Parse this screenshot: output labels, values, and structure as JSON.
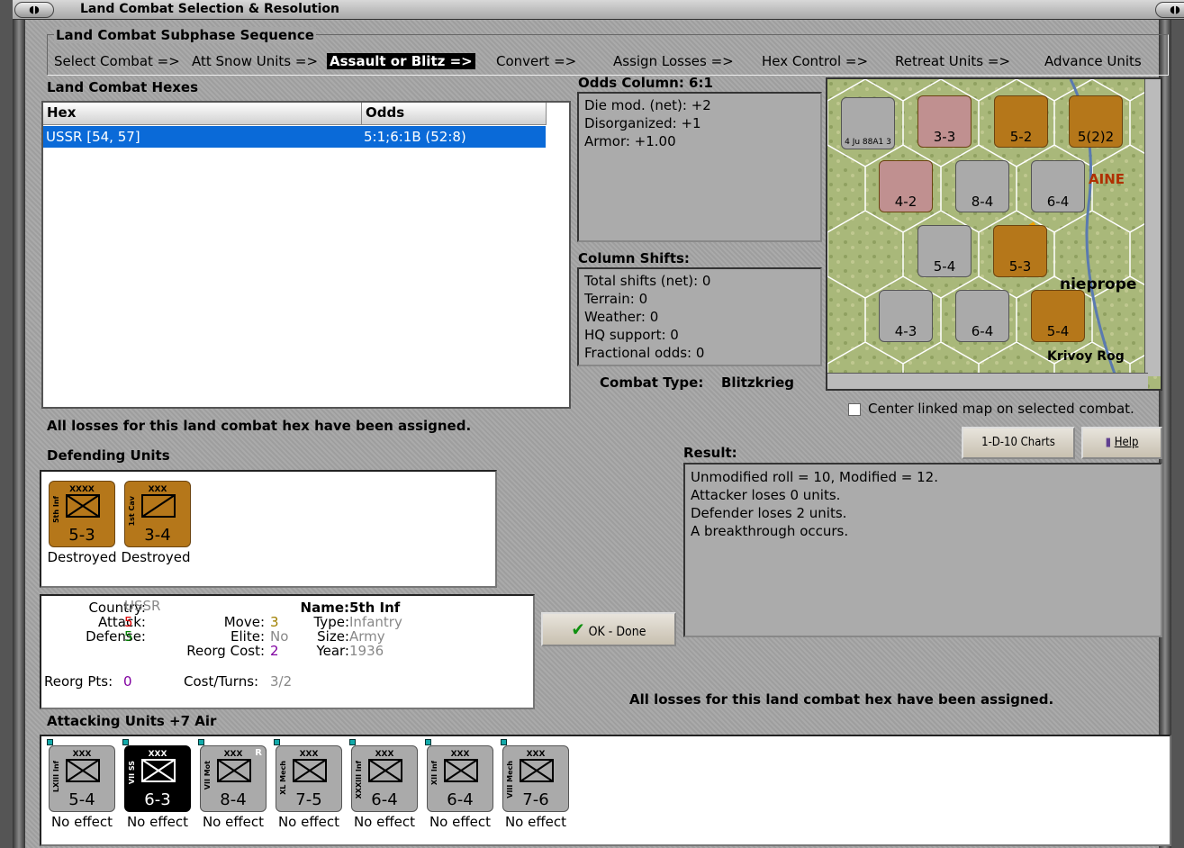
{
  "window": {
    "title": "Land Combat Selection & Resolution"
  },
  "sequence": {
    "title": "Land Combat Subphase Sequence",
    "steps": [
      "Select Combat =>",
      "Att Snow Units =>",
      "Assault or Blitz =>",
      "Convert =>",
      "Assign Losses =>",
      "Hex Control =>",
      "Retreat Units =>",
      "Advance Units"
    ],
    "active_step": "Assault or Blitz =>"
  },
  "combat_hexes": {
    "title": "Land Combat Hexes",
    "columns": [
      "Hex",
      "Odds"
    ],
    "rows": [
      {
        "hex": "USSR [54, 57]",
        "odds": "5:1;6:1B (52:8)"
      }
    ]
  },
  "odds": {
    "title": "Odds Column: 6:1",
    "lines": [
      "Die mod. (net): +2",
      "Disorganized: +1",
      "Armor: +1.00"
    ]
  },
  "shifts": {
    "title": "Column Shifts:",
    "lines": [
      "Total shifts (net): 0",
      "Terrain: 0",
      "Weather: 0",
      "HQ support: 0",
      "Fractional odds: 0"
    ]
  },
  "combat_type": {
    "label": "Combat Type:",
    "value": "Blitzkrieg"
  },
  "map": {
    "center_checkbox_label": "Center linked map on selected combat.",
    "place_labels": [
      "AINE",
      "nieprope",
      "Krivoy Rog"
    ]
  },
  "buttons": {
    "charts": "1-D-10 Charts",
    "help": "Help",
    "ok": "OK - Done"
  },
  "losses_message": "All losses for this land combat hex have been assigned.",
  "result": {
    "title": "Result:",
    "lines": [
      "Unmodified roll = 10, Modified = 12.",
      "Attacker loses 0 units.",
      "Defender loses 2 units.",
      "A breakthrough occurs."
    ]
  },
  "defending": {
    "title": "Defending Units",
    "units": [
      {
        "size": "XXXX",
        "name": "5th Inf",
        "values": "5-3",
        "status": "Destroyed"
      },
      {
        "size": "XXX",
        "name": "1st Cav",
        "values": "3-4",
        "status": "Destroyed"
      }
    ]
  },
  "unit_detail": {
    "country_label": "Country:",
    "country": "USSR",
    "attack_label": "Attack:",
    "attack": "5",
    "defense_label": "Defense:",
    "defense": "5",
    "move_label": "Move:",
    "move": "3",
    "elite_label": "Elite:",
    "elite": "No",
    "reorg_cost_label": "Reorg Cost:",
    "reorg_cost": "2",
    "name_label": "Name:",
    "name": "5th Inf",
    "type_label": "Type:",
    "type": "Infantry",
    "size_label": "Size:",
    "size": "Army",
    "year_label": "Year:",
    "year": "1936",
    "reorg_pts_label": "Reorg Pts:",
    "reorg_pts": "0",
    "cost_turns_label": "Cost/Turns:",
    "cost_turns": "3/2"
  },
  "attacking": {
    "title": "Attacking Units +7 Air",
    "units": [
      {
        "size": "XXX",
        "name": "LXIII Inf",
        "values": "5-4",
        "status": "No effect",
        "style": "gray"
      },
      {
        "size": "XXX",
        "name": "VII SS",
        "values": "6-3",
        "status": "No effect",
        "style": "black"
      },
      {
        "size": "XXX",
        "name": "VII Mot",
        "values": "8-4",
        "status": "No effect",
        "style": "gray",
        "tag": "R"
      },
      {
        "size": "XXX",
        "name": "XL Mech",
        "values": "7-5",
        "status": "No effect",
        "style": "gray"
      },
      {
        "size": "XXX",
        "name": "XXXIII Inf",
        "values": "6-4",
        "status": "No effect",
        "style": "gray"
      },
      {
        "size": "XXX",
        "name": "XII Inf",
        "values": "6-4",
        "status": "No effect",
        "style": "gray"
      },
      {
        "size": "XXX",
        "name": "VIII Mech",
        "values": "7-6",
        "status": "No effect",
        "style": "gray"
      }
    ]
  },
  "colors": {
    "selection": "#0a6ad8",
    "ussr_counter": "#b5771a",
    "axis_counter": "#aaaaaa",
    "attack_red": "#e00000",
    "defense_green": "#008000",
    "move_olive": "#a08000",
    "reorg_purple": "#8000a0"
  }
}
